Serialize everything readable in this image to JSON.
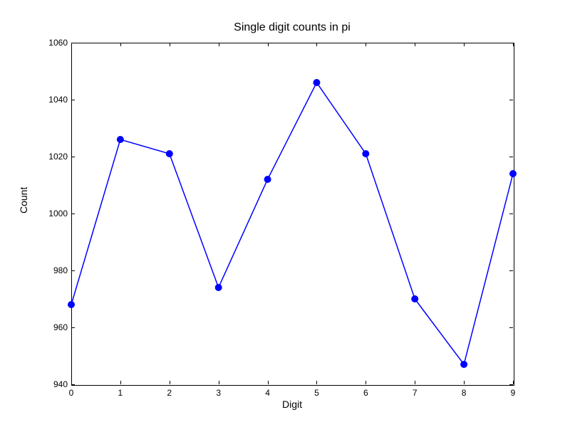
{
  "chart_data": {
    "type": "line",
    "title": "Single digit counts in pi",
    "xlabel": "Digit",
    "ylabel": "Count",
    "categories": [
      0,
      1,
      2,
      3,
      4,
      5,
      6,
      7,
      8,
      9
    ],
    "values": [
      968,
      1026,
      1021,
      974,
      1012,
      1046,
      1021,
      970,
      947,
      1014
    ],
    "xlim": [
      0,
      9
    ],
    "ylim": [
      940,
      1060
    ],
    "y_ticks": [
      940,
      960,
      980,
      1000,
      1020,
      1040,
      1060
    ],
    "x_ticks": [
      0,
      1,
      2,
      3,
      4,
      5,
      6,
      7,
      8,
      9
    ]
  }
}
